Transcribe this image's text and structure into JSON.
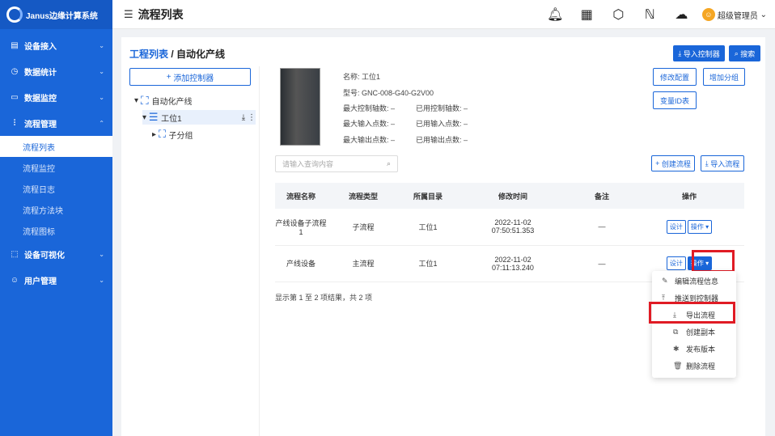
{
  "app": {
    "name": "Janus边缘计算系统"
  },
  "sidebar": {
    "items": [
      {
        "label": "设备接入",
        "icon": "server-icon"
      },
      {
        "label": "数据统计",
        "icon": "clock-icon"
      },
      {
        "label": "数据监控",
        "icon": "monitor-icon"
      },
      {
        "label": "流程管理",
        "icon": "flow-icon"
      }
    ],
    "sub": [
      "流程列表",
      "流程监控",
      "流程日志",
      "流程方法块",
      "流程图标"
    ],
    "after": [
      {
        "label": "设备可视化",
        "icon": "visual-icon"
      },
      {
        "label": "用户管理",
        "icon": "user-icon"
      }
    ]
  },
  "header": {
    "title": "流程列表",
    "user": "超级管理员"
  },
  "breadcrumb": {
    "root": "工程列表",
    "sep": "/",
    "current": "自动化产线"
  },
  "toolbar": {
    "import_ctrl": "导入控制器",
    "search": "搜索",
    "add_ctrl": "添加控制器",
    "edit_config": "修改配置",
    "add_group": "增加分组",
    "var_table": "变量ID表",
    "create_flow": "创建流程",
    "import_flow": "导入流程"
  },
  "tree": {
    "root": "自动化产线",
    "station": "工位1",
    "subgroup": "子分组"
  },
  "device": {
    "name": "名称: 工位1",
    "model": "型号: GNC-008-G40-G2V00",
    "axis": "最大控制轴数: –",
    "used_axis": "已用控制轴数: –",
    "in": "最大输入点数: –",
    "used_in": "已用输入点数: –",
    "out": "最大输出点数: –",
    "used_out": "已用输出点数: –"
  },
  "search": {
    "placeholder": "请输入查询内容"
  },
  "table": {
    "headers": [
      "流程名称",
      "流程类型",
      "所属目录",
      "修改时间",
      "备注",
      "操作"
    ],
    "rows": [
      {
        "name": "产线设备子流程1",
        "type": "子流程",
        "dir": "工位1",
        "date": "2022-11-02",
        "time": "07:50:51.353",
        "note": "—"
      },
      {
        "name": "产线设备",
        "type": "主流程",
        "dir": "工位1",
        "date": "2022-11-02",
        "time": "07:11:13.240",
        "note": "—"
      }
    ],
    "design": "设计",
    "ops": "操作"
  },
  "footer": "显示第 1 至 2 项结果，共 2 项",
  "menu": [
    "编辑流程信息",
    "推送到控制器",
    "导出流程",
    "创建副本",
    "发布版本",
    "删除流程"
  ]
}
